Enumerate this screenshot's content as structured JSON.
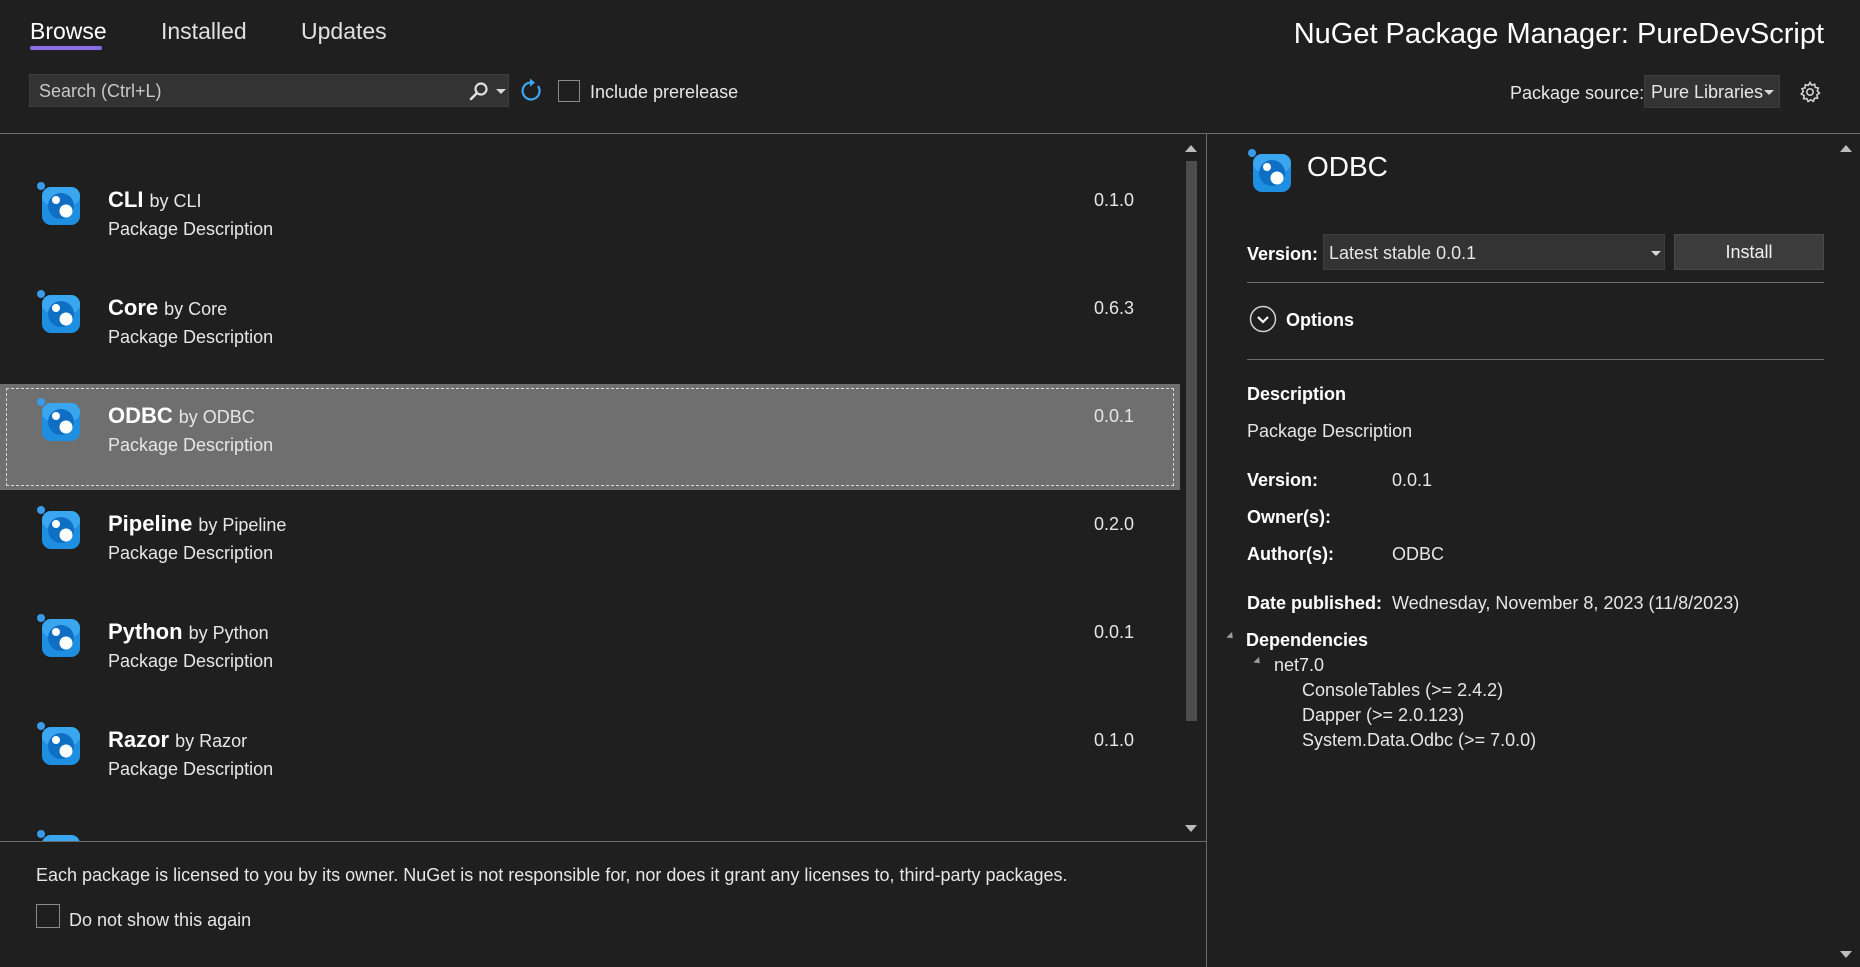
{
  "tabs": [
    {
      "label": "Browse",
      "active": true
    },
    {
      "label": "Installed",
      "active": false
    },
    {
      "label": "Updates",
      "active": false
    }
  ],
  "window_title": "NuGet Package Manager: PureDevScript",
  "search": {
    "placeholder": "Search (Ctrl+L)",
    "value": ""
  },
  "include_prerelease": {
    "label": "Include prerelease",
    "checked": false
  },
  "package_source": {
    "label": "Package source:",
    "selected": "Pure Libraries"
  },
  "packages": [
    {
      "name": "CLI",
      "by": "by CLI",
      "description": "Package Description",
      "version": "0.1.0",
      "selected": false
    },
    {
      "name": "Core",
      "by": "by Core",
      "description": "Package Description",
      "version": "0.6.3",
      "selected": false
    },
    {
      "name": "ODBC",
      "by": "by ODBC",
      "description": "Package Description",
      "version": "0.0.1",
      "selected": true
    },
    {
      "name": "Pipeline",
      "by": "by Pipeline",
      "description": "Package Description",
      "version": "0.2.0",
      "selected": false
    },
    {
      "name": "Python",
      "by": "by Python",
      "description": "Package Description",
      "version": "0.0.1",
      "selected": false
    },
    {
      "name": "Razor",
      "by": "by Razor",
      "description": "Package Description",
      "version": "0.1.0",
      "selected": false
    }
  ],
  "license_notice": "Each package is licensed to you by its owner. NuGet is not responsible for, nor does it grant any licenses to, third-party packages.",
  "do_not_show": {
    "label": "Do not show this again",
    "checked": false
  },
  "detail": {
    "title": "ODBC",
    "version_label": "Version:",
    "version_selected": "Latest stable 0.0.1",
    "install_label": "Install",
    "options_label": "Options",
    "description_heading": "Description",
    "description_text": "Package Description",
    "fields": {
      "version_label": "Version:",
      "version_value": "0.0.1",
      "owners_label": "Owner(s):",
      "owners_value": "",
      "authors_label": "Author(s):",
      "authors_value": "ODBC",
      "date_label": "Date published:",
      "date_value": "Wednesday, November 8, 2023 (11/8/2023)"
    },
    "dependencies": {
      "heading": "Dependencies",
      "framework": "net7.0",
      "items": [
        "ConsoleTables (>= 2.4.2)",
        "Dapper (>= 2.0.123)",
        "System.Data.Odbc (>= 7.0.0)"
      ]
    }
  },
  "colors": {
    "background": "#1f1f1f",
    "accent": "#8c6ee8",
    "selected_row": "#6f6f6f",
    "icon_blue": "#1e8fe0"
  },
  "icons": [
    "search-icon",
    "refresh-icon",
    "settings-gear-icon",
    "package-icon",
    "chevron-down-icon"
  ]
}
